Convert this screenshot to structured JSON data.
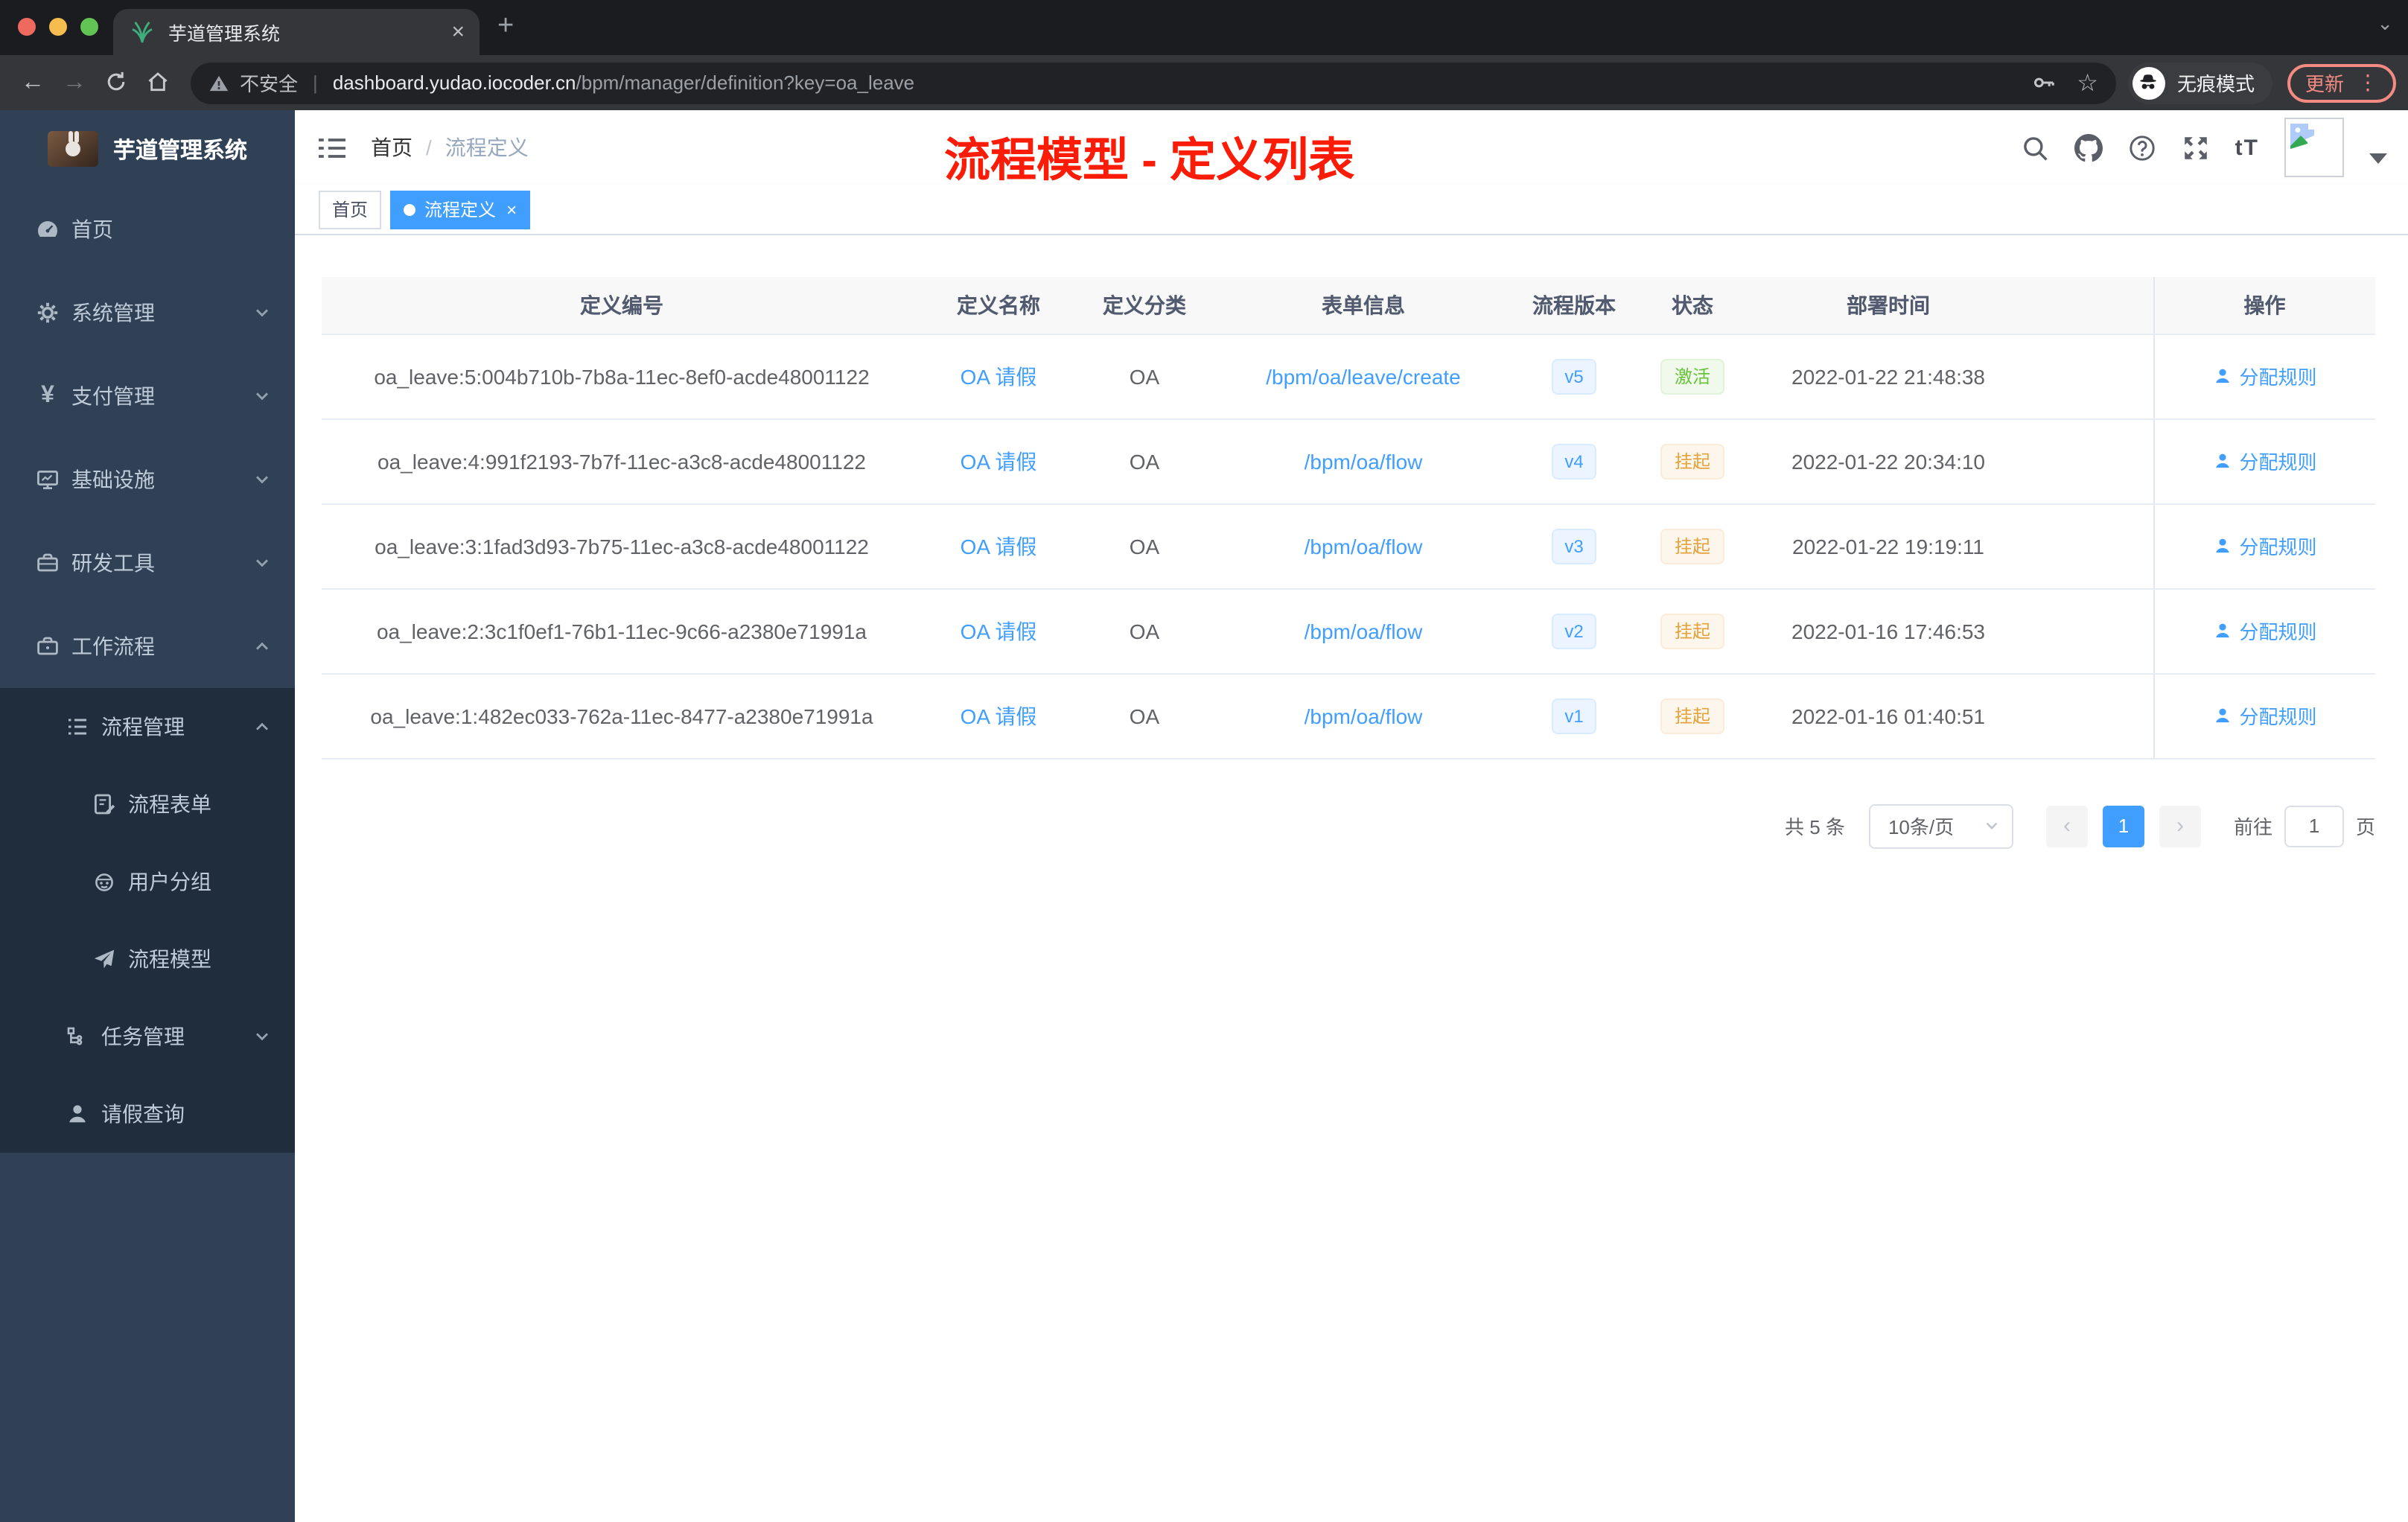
{
  "browser": {
    "tab": {
      "title": "芋道管理系统",
      "close_glyph": "×",
      "new_tab_glyph": "+",
      "tabsearch_glyph": "⌄"
    },
    "toolbar": {
      "back_glyph": "←",
      "forward_glyph": "→",
      "security_label": "不安全",
      "url_host": "dashboard.yudao.iocoder.cn",
      "url_path": "/bpm/manager/definition?key=oa_leave",
      "star_glyph": "☆",
      "incognito_label": "无痕模式",
      "update_label": "更新",
      "menu_glyph": "⋮"
    }
  },
  "app": {
    "sidebar": {
      "title": "芋道管理系统",
      "items": [
        {
          "label": "首页",
          "icon": "dashboard-icon"
        },
        {
          "label": "系统管理",
          "icon": "gear-icon",
          "expand": "down"
        },
        {
          "label": "支付管理",
          "icon": "yen-icon",
          "glyph": "¥",
          "expand": "down"
        },
        {
          "label": "基础设施",
          "icon": "monitor-icon",
          "expand": "down"
        },
        {
          "label": "研发工具",
          "icon": "toolbox-icon",
          "expand": "down"
        },
        {
          "label": "工作流程",
          "icon": "briefcase-icon",
          "expand": "up"
        },
        {
          "label": "流程管理",
          "icon": "list-icon",
          "expand": "up",
          "level": 1
        },
        {
          "label": "流程表单",
          "icon": "form-icon",
          "level": 2
        },
        {
          "label": "用户分组",
          "icon": "robot-icon",
          "level": 2
        },
        {
          "label": "流程模型",
          "icon": "paper-plane-icon",
          "level": 2
        },
        {
          "label": "任务管理",
          "icon": "org-tree-icon",
          "expand": "down",
          "level": 1
        },
        {
          "label": "请假查询",
          "icon": "user-icon",
          "level": 1
        }
      ]
    },
    "header": {
      "breadcrumb": {
        "home": "首页",
        "separator": "/",
        "current": "流程定义"
      },
      "annotation": "流程模型 - 定义列表",
      "fontsize_glyph": "tT",
      "icons": [
        "search-icon",
        "github-icon",
        "question-icon",
        "fullscreen-icon",
        "fontsize-icon",
        "avatar-broken-image",
        "caret-down-icon"
      ]
    },
    "tags": {
      "home": "首页",
      "active": "流程定义",
      "close_glyph": "×"
    },
    "table": {
      "columns": [
        "定义编号",
        "定义名称",
        "定义分类",
        "表单信息",
        "流程版本",
        "状态",
        "部署时间",
        "操作"
      ],
      "rows": [
        {
          "id": "oa_leave:5:004b710b-7b8a-11ec-8ef0-acde48001122",
          "name": "OA 请假",
          "category": "OA",
          "form": "/bpm/oa/leave/create",
          "version": "v5",
          "status": "激活",
          "status_type": "success",
          "time": "2022-01-22 21:48:38",
          "action": "分配规则"
        },
        {
          "id": "oa_leave:4:991f2193-7b7f-11ec-a3c8-acde48001122",
          "name": "OA 请假",
          "category": "OA",
          "form": "/bpm/oa/flow",
          "version": "v4",
          "status": "挂起",
          "status_type": "warning",
          "time": "2022-01-22 20:34:10",
          "action": "分配规则"
        },
        {
          "id": "oa_leave:3:1fad3d93-7b75-11ec-a3c8-acde48001122",
          "name": "OA 请假",
          "category": "OA",
          "form": "/bpm/oa/flow",
          "version": "v3",
          "status": "挂起",
          "status_type": "warning",
          "time": "2022-01-22 19:19:11",
          "action": "分配规则"
        },
        {
          "id": "oa_leave:2:3c1f0ef1-76b1-11ec-9c66-a2380e71991a",
          "name": "OA 请假",
          "category": "OA",
          "form": "/bpm/oa/flow",
          "version": "v2",
          "status": "挂起",
          "status_type": "warning",
          "time": "2022-01-16 17:46:53",
          "action": "分配规则"
        },
        {
          "id": "oa_leave:1:482ec033-762a-11ec-8477-a2380e71991a",
          "name": "OA 请假",
          "category": "OA",
          "form": "/bpm/oa/flow",
          "version": "v1",
          "status": "挂起",
          "status_type": "warning",
          "time": "2022-01-16 01:40:51",
          "action": "分配规则"
        }
      ]
    },
    "pagination": {
      "total": "共 5 条",
      "page_size": "10条/页",
      "prev_glyph": "‹",
      "page": "1",
      "next_glyph": "›",
      "goto_label": "前往",
      "goto_value": "1",
      "goto_suffix": "页"
    }
  },
  "colors": {
    "primary": "#409eff",
    "success": "#67c23a",
    "warning": "#e6a23c",
    "annotation_red": "#fb1c08",
    "sidebar_bg": "#304156",
    "submenu_bg": "#1f2d3d",
    "active_tag_bg": "#409eff"
  }
}
